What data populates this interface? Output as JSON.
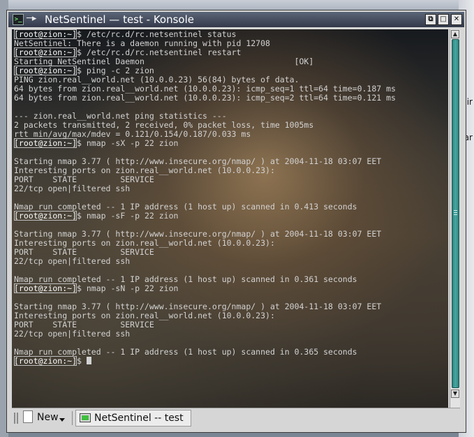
{
  "window": {
    "title": "NetSentinel — test - Konsole",
    "app_icon_text": ">_",
    "pin_glyph": "─▸",
    "buttons": {
      "restore": "⧉",
      "maximize": "□",
      "close": "✕"
    }
  },
  "terminal": {
    "lines": [
      {
        "prompt": "[root@zion:~]",
        "text": "$ /etc/rc.d/rc.netsentinel status"
      },
      {
        "prompt": "",
        "text": "NetSentinel: There is a daemon running with pid 12708"
      },
      {
        "prompt": "[root@zion:~]",
        "text": "$ /etc/rc.d/rc.netsentinel restart"
      },
      {
        "prompt": "",
        "text": "Starting NetSentinel Daemon                               [OK]"
      },
      {
        "prompt": "[root@zion:~]",
        "text": "$ ping -c 2 zion"
      },
      {
        "prompt": "",
        "text": "PING zion.real__world.net (10.0.0.23) 56(84) bytes of data."
      },
      {
        "prompt": "",
        "text": "64 bytes from zion.real__world.net (10.0.0.23): icmp_seq=1 ttl=64 time=0.187 ms"
      },
      {
        "prompt": "",
        "text": "64 bytes from zion.real__world.net (10.0.0.23): icmp_seq=2 ttl=64 time=0.121 ms"
      },
      {
        "prompt": "",
        "text": ""
      },
      {
        "prompt": "",
        "text": "--- zion.real__world.net ping statistics ---"
      },
      {
        "prompt": "",
        "text": "2 packets transmitted, 2 received, 0% packet loss, time 1005ms"
      },
      {
        "prompt": "",
        "text": "rtt min/avg/max/mdev = 0.121/0.154/0.187/0.033 ms"
      },
      {
        "prompt": "[root@zion:~]",
        "text": "$ nmap -sX -p 22 zion"
      },
      {
        "prompt": "",
        "text": ""
      },
      {
        "prompt": "",
        "text": "Starting nmap 3.77 ( http://www.insecure.org/nmap/ ) at 2004-11-18 03:07 EET"
      },
      {
        "prompt": "",
        "text": "Interesting ports on zion.real__world.net (10.0.0.23):"
      },
      {
        "prompt": "",
        "text": "PORT    STATE         SERVICE"
      },
      {
        "prompt": "",
        "text": "22/tcp open|filtered ssh"
      },
      {
        "prompt": "",
        "text": ""
      },
      {
        "prompt": "",
        "text": "Nmap run completed -- 1 IP address (1 host up) scanned in 0.413 seconds"
      },
      {
        "prompt": "[root@zion:~]",
        "text": "$ nmap -sF -p 22 zion"
      },
      {
        "prompt": "",
        "text": ""
      },
      {
        "prompt": "",
        "text": "Starting nmap 3.77 ( http://www.insecure.org/nmap/ ) at 2004-11-18 03:07 EET"
      },
      {
        "prompt": "",
        "text": "Interesting ports on zion.real__world.net (10.0.0.23):"
      },
      {
        "prompt": "",
        "text": "PORT    STATE         SERVICE"
      },
      {
        "prompt": "",
        "text": "22/tcp open|filtered ssh"
      },
      {
        "prompt": "",
        "text": ""
      },
      {
        "prompt": "",
        "text": "Nmap run completed -- 1 IP address (1 host up) scanned in 0.361 seconds"
      },
      {
        "prompt": "[root@zion:~]",
        "text": "$ nmap -sN -p 22 zion"
      },
      {
        "prompt": "",
        "text": ""
      },
      {
        "prompt": "",
        "text": "Starting nmap 3.77 ( http://www.insecure.org/nmap/ ) at 2004-11-18 03:07 EET"
      },
      {
        "prompt": "",
        "text": "Interesting ports on zion.real__world.net (10.0.0.23):"
      },
      {
        "prompt": "",
        "text": "PORT    STATE         SERVICE"
      },
      {
        "prompt": "",
        "text": "22/tcp open|filtered ssh"
      },
      {
        "prompt": "",
        "text": ""
      },
      {
        "prompt": "",
        "text": "Nmap run completed -- 1 IP address (1 host up) scanned in 0.365 seconds"
      },
      {
        "prompt": "[root@zion:~]",
        "text": "$ "
      }
    ]
  },
  "scrollbar": {
    "up_glyph": "▲",
    "down_glyph": "▼"
  },
  "tabbar": {
    "new_label": "New",
    "session_label": "NetSentinel -- test"
  },
  "desktop": {
    "fragment_1": "ir",
    "fragment_2": "ar"
  },
  "colors": {
    "scroll_accent": "#3a9a94",
    "title_bg": "#3e4658"
  }
}
